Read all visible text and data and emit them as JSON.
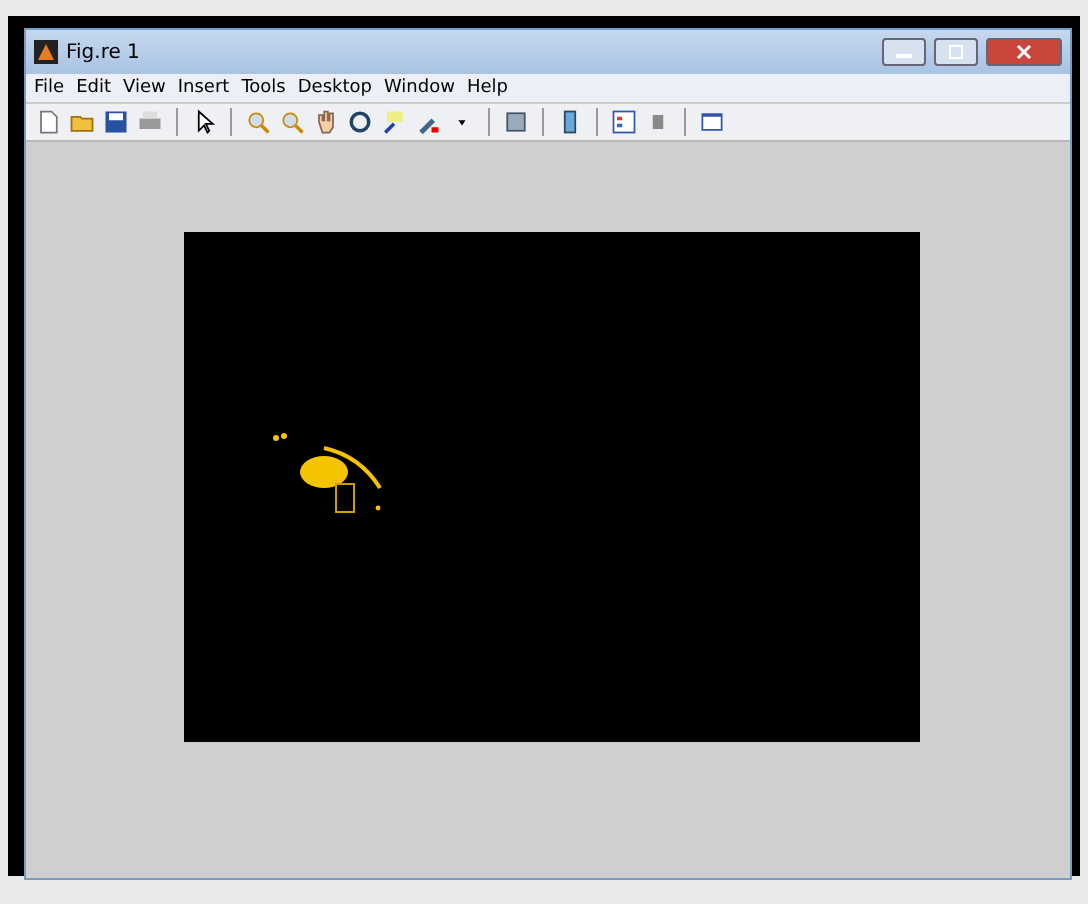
{
  "window": {
    "title": "Fig.re 1"
  },
  "menu": [
    "File",
    "Edit",
    "View",
    "Insert",
    "Tools",
    "Desktop",
    "Window",
    "Help"
  ]
}
